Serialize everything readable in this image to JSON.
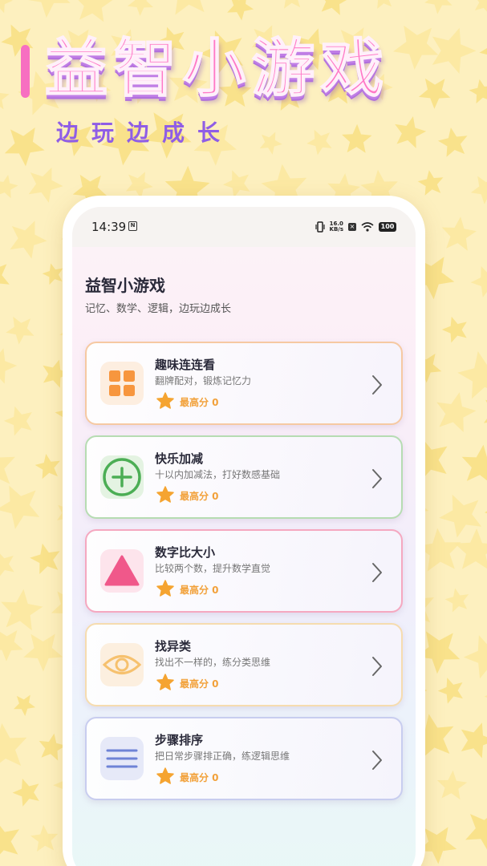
{
  "banner": {
    "title": "益智小游戏",
    "subtitle": "边玩边成长"
  },
  "status_bar": {
    "time": "14:39",
    "sim_label": "N",
    "net_speed_value": "16.0",
    "net_speed_unit": "KB/s",
    "battery": "100"
  },
  "page": {
    "title": "益智小游戏",
    "subtitle": "记忆、数学、逻辑，边玩边成长"
  },
  "games": [
    {
      "title": "趣味连连看",
      "desc": "翻牌配对，锻炼记忆力",
      "score_label": "最高分 0",
      "icon": "grid-icon",
      "border": "#f6c9a2",
      "icon_bg": "#fdeee0",
      "icon_color": "#f7963e"
    },
    {
      "title": "快乐加减",
      "desc": "十以内加减法，打好数感基础",
      "score_label": "最高分 0",
      "icon": "plus-circle-icon",
      "border": "#b6dcb2",
      "icon_bg": "#e4f3e2",
      "icon_color": "#4cae55"
    },
    {
      "title": "数字比大小",
      "desc": "比较两个数，提升数学直觉",
      "score_label": "最高分 0",
      "icon": "triangle-icon",
      "border": "#f5a8c0",
      "icon_bg": "#fde4ec",
      "icon_color": "#f0588a"
    },
    {
      "title": "找异类",
      "desc": "找出不一样的，练分类思维",
      "score_label": "最高分 0",
      "icon": "eye-icon",
      "border": "#f6dcaf",
      "icon_bg": "#fcefdf",
      "icon_color": "#f6c16e"
    },
    {
      "title": "步骤排序",
      "desc": "把日常步骤排正确，练逻辑思维",
      "score_label": "最高分 0",
      "icon": "list-icon",
      "border": "#c8cdef",
      "icon_bg": "#e6e9f8",
      "icon_color": "#6e83d6"
    }
  ]
}
